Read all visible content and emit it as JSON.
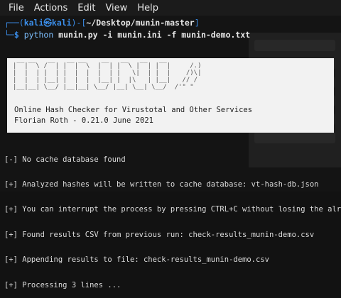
{
  "menubar": {
    "items": [
      "File",
      "Actions",
      "Edit",
      "View",
      "Help"
    ]
  },
  "prompt": {
    "open": "┌──(",
    "user": "kali㉿kali",
    "mid": ")-[",
    "path": "~/Desktop/munin-master",
    "close": "]",
    "dollar": "└─$ ",
    "command": "python",
    "args": " munin.py -i munin.ini -f munin-demo.txt"
  },
  "banner": {
    "ascii": "|‾‾|‾‾\\ /‾‾| |‾‾|‾‾\\  |‾‾| |‾‾\\ |‾‾| |‾‾|     /.)\n|  |  | |  | |  |  |  |  | |   \\|  | |  |    /)\\|\n|  |  | |__| |  |  |  |__| |  |\\   | |__|   // /\n|__|__| \\__/ |__|__| \\__/ |__| \\__| \\__/  /'\" \"",
    "title": "Online Hash Checker for Virustotal and Other Services",
    "author": "Florian Roth - 0.21.0 June 2021"
  },
  "logs": [
    "[-] No cache database found",
    "[+] Analyzed hashes will be written to cache database: vt-hash-db.json",
    "[+] You can interrupt the process by pressing CTRL+C without losing the already gathered",
    "[+] Found results CSV from previous run: check-results_munin-demo.csv",
    "[+] Appending results to file: check-results_munin-demo.csv",
    "[+] Processing 3 lines ..."
  ]
}
